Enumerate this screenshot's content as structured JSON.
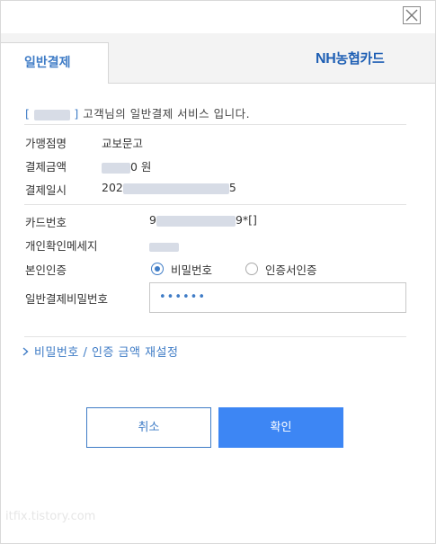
{
  "window": {
    "close_icon": "close-icon"
  },
  "tab": {
    "label": "일반결제"
  },
  "brand": {
    "nh": "NH",
    "rest": "농협카드",
    "color": "#1e5fb4"
  },
  "notice": {
    "open": "[",
    "close": "]",
    "text": "고객님의 일반결제 서비스 입니다."
  },
  "order": {
    "merchant_label": "가맹점명",
    "merchant_value": "교보문고",
    "amount_label": "결제금액",
    "amount_suffix": "0 원",
    "datetime_label": "결제일시",
    "datetime_prefix": "202",
    "datetime_suffix": "5"
  },
  "card": {
    "number_label": "카드번호",
    "number_prefix": "9",
    "number_suffix": "9*[]",
    "message_label": "개인확인메세지",
    "auth_label": "본인인증",
    "auth_options": [
      {
        "label": "비밀번호",
        "selected": true
      },
      {
        "label": "인증서인증",
        "selected": false
      }
    ],
    "pw_label": "일반결제비밀번호",
    "pw_value": "••••••"
  },
  "reset": {
    "label": "비밀번호 / 인증 금액 재설정"
  },
  "buttons": {
    "cancel": "취소",
    "ok": "확인"
  },
  "watermark": "itfix.tistory.com",
  "colors": {
    "accent": "#3f7cc6",
    "primary_button": "#3d86f4"
  }
}
